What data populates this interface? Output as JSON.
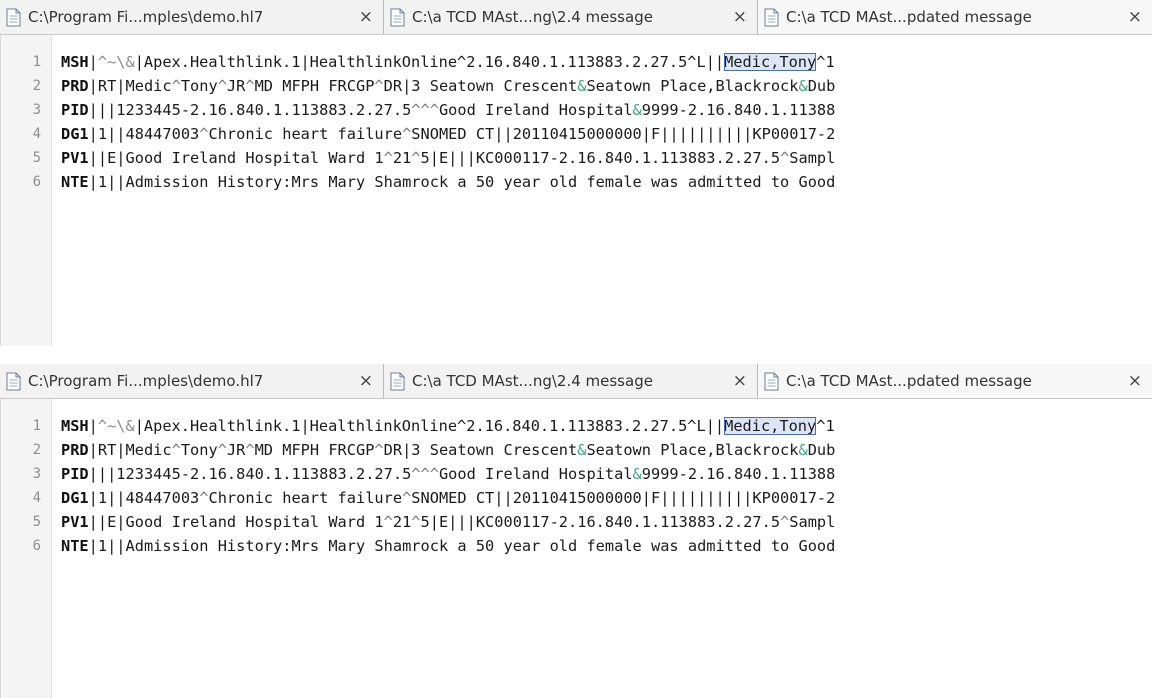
{
  "panes": [
    {
      "tabs": [
        {
          "label": "C:\\Program Fi...mples\\demo.hl7",
          "close": "×"
        },
        {
          "label": "C:\\a TCD MAst...ng\\2.4 message",
          "close": "×"
        },
        {
          "label": "C:\\a TCD MAst...pdated message",
          "close": "×"
        }
      ],
      "lines": [
        {
          "n": "1",
          "segment": "MSH",
          "rest_html_parts": [
            "|",
            "^~\\&",
            "|Apex.Healthlink.1|HealthlinkOnline^2.16.840.1.113883.2.27.5^L||",
            "Medic,Tony",
            "^1"
          ]
        },
        {
          "n": "2",
          "segment": "PRD",
          "rest": "|RT|Medic^Tony^JR^MD MFPH FRCGP^DR|3 Seatown Crescent&Seatown Place,Blackrock&Dub"
        },
        {
          "n": "3",
          "segment": "PID",
          "rest": "|||1233445-2.16.840.1.113883.2.27.5^^^Good Ireland Hospital&9999-2.16.840.1.11388"
        },
        {
          "n": "4",
          "segment": "DG1",
          "rest": "|1||48447003^Chronic heart failure^SNOMED CT||20110415000000|F||||||||||KP00017-2"
        },
        {
          "n": "5",
          "segment": "PV1",
          "rest": "||E|Good Ireland Hospital Ward 1^21^5|E|||KC000117-2.16.840.1.113883.2.27.5^Sampl"
        },
        {
          "n": "6",
          "segment": "NTE",
          "rest": "|1||Admission History:Mrs Mary Shamrock a 50 year old female was admitted to Good"
        }
      ]
    },
    {
      "tabs": [
        {
          "label": "C:\\Program Fi...mples\\demo.hl7",
          "close": "×"
        },
        {
          "label": "C:\\a TCD MAst...ng\\2.4 message",
          "close": "×"
        },
        {
          "label": "C:\\a TCD MAst...pdated message",
          "close": "×"
        }
      ],
      "lines": [
        {
          "n": "1",
          "segment": "MSH",
          "rest_html_parts": [
            "|",
            "^~\\&",
            "|Apex.Healthlink.1|HealthlinkOnline^2.16.840.1.113883.2.27.5^L||",
            "Medic,Tony",
            "^1"
          ]
        },
        {
          "n": "2",
          "segment": "PRD",
          "rest": "|RT|Medic^Tony^JR^MD MFPH FRCGP^DR|3 Seatown Crescent&Seatown Place,Blackrock&Dub"
        },
        {
          "n": "3",
          "segment": "PID",
          "rest": "|||1233445-2.16.840.1.113883.2.27.5^^^Good Ireland Hospital&9999-2.16.840.1.11388"
        },
        {
          "n": "4",
          "segment": "DG1",
          "rest": "|1||48447003^Chronic heart failure^SNOMED CT||20110415000000|F||||||||||KP00017-2"
        },
        {
          "n": "5",
          "segment": "PV1",
          "rest": "||E|Good Ireland Hospital Ward 1^21^5|E|||KC000117-2.16.840.1.113883.2.27.5^Sampl"
        },
        {
          "n": "6",
          "segment": "NTE",
          "rest": "|1||Admission History:Mrs Mary Shamrock a 50 year old female was admitted to Good"
        }
      ]
    }
  ],
  "colors": {
    "delimiter_ampersand": "#3aa57a",
    "selection_fill": "#dde6f7",
    "selection_border": "#4a6cb8"
  },
  "icons": {
    "tab_icon": "document-icon",
    "tab_close": "close-icon"
  }
}
